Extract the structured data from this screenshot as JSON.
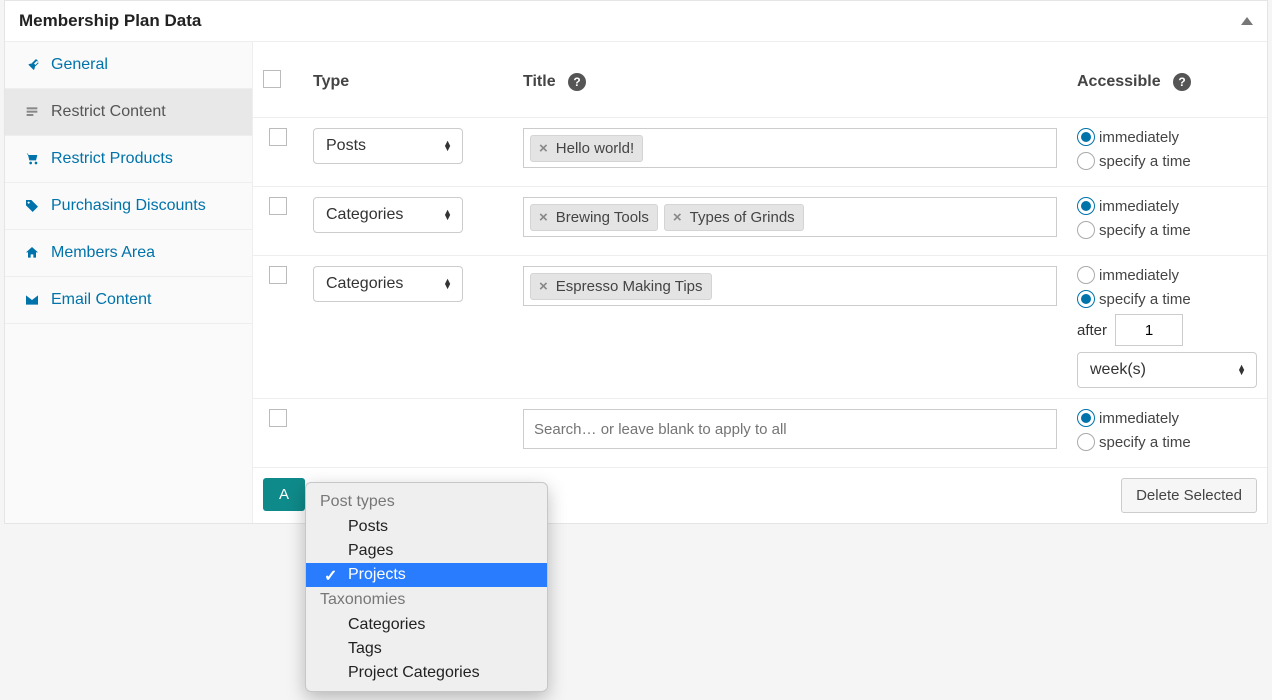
{
  "panel": {
    "title": "Membership Plan Data"
  },
  "tabs": [
    {
      "id": "general",
      "label": "General",
      "icon": "wrench"
    },
    {
      "id": "restrict",
      "label": "Restrict Content",
      "icon": "doc",
      "active": true
    },
    {
      "id": "products",
      "label": "Restrict Products",
      "icon": "cart"
    },
    {
      "id": "discount",
      "label": "Purchasing Discounts",
      "icon": "tag"
    },
    {
      "id": "members",
      "label": "Members Area",
      "icon": "home"
    },
    {
      "id": "email",
      "label": "Email Content",
      "icon": "mail"
    }
  ],
  "columns": {
    "type": "Type",
    "title": "Title",
    "access": "Accessible"
  },
  "rows": [
    {
      "type": "Posts",
      "tags": [
        "Hello world!"
      ],
      "access": {
        "immediately": true,
        "specify": false
      }
    },
    {
      "type": "Categories",
      "tags": [
        "Brewing Tools",
        "Types of Grinds"
      ],
      "access": {
        "immediately": true,
        "specify": false
      }
    },
    {
      "type": "Categories",
      "tags": [
        "Espresso Making Tips"
      ],
      "access": {
        "immediately": false,
        "specify": true,
        "after_label": "after",
        "after_value": "1",
        "unit": "week(s)"
      }
    },
    {
      "type": "",
      "tags": [],
      "placeholder": "Search… or leave blank to apply to all",
      "access": {
        "immediately": true,
        "specify": false
      }
    }
  ],
  "access_labels": {
    "immediately": "immediately",
    "specify": "specify a time"
  },
  "dropdown": {
    "groups": [
      {
        "label": "Post types",
        "options": [
          "Posts",
          "Pages",
          "Projects"
        ]
      },
      {
        "label": "Taxonomies",
        "options": [
          "Categories",
          "Tags",
          "Project Categories"
        ]
      }
    ],
    "selected": "Projects"
  },
  "buttons": {
    "add_prefix": "A",
    "delete": "Delete Selected"
  }
}
